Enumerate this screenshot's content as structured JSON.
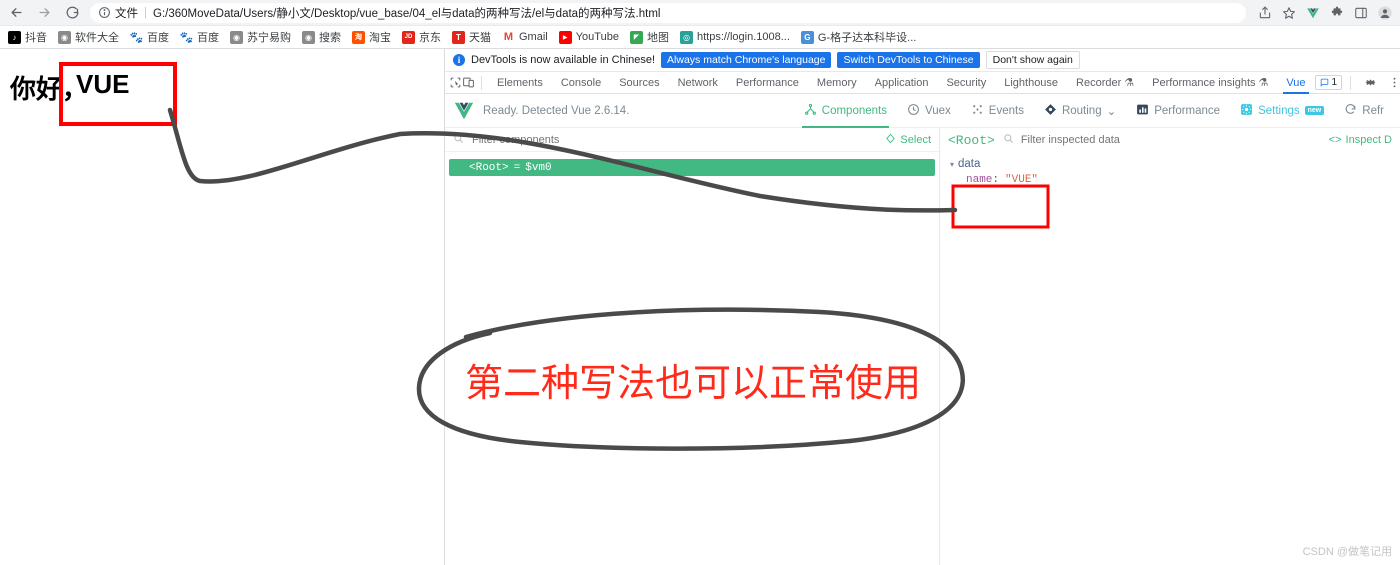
{
  "browser": {
    "nav": {
      "back": "Back",
      "forward": "Forward",
      "reload": "Reload"
    },
    "omnibox": {
      "scheme_label": "文件",
      "url": "G:/360MoveData/Users/静小文/Desktop/vue_base/04_el与data的两种写法/el与data的两种写法.html"
    },
    "toolbar_icons": [
      "share-icon",
      "bookmark-star-icon",
      "vue-extension-icon",
      "extensions-puzzle-icon",
      "side-panel-icon",
      "profile-icon"
    ],
    "bookmarks": [
      {
        "label": "抖音",
        "icon": "douyin-icon",
        "color": "#000000",
        "glyph": "♪"
      },
      {
        "label": "软件大全",
        "icon": "globe-icon",
        "color": "#7c7c7c",
        "glyph": "◉"
      },
      {
        "label": "百度",
        "icon": "baidu-icon",
        "color": "#2932e1",
        "glyph": "熊"
      },
      {
        "label": "百度",
        "icon": "baidu-icon",
        "color": "#2932e1",
        "glyph": "熊"
      },
      {
        "label": "苏宁易购",
        "icon": "globe-icon",
        "color": "#7c7c7c",
        "glyph": "◉"
      },
      {
        "label": "搜索",
        "icon": "globe-icon",
        "color": "#7c7c7c",
        "glyph": "◉"
      },
      {
        "label": "淘宝",
        "icon": "taobao-icon",
        "color": "#ff5000",
        "glyph": "淘"
      },
      {
        "label": "京东",
        "icon": "jd-icon",
        "color": "#e1251b",
        "glyph": "JD"
      },
      {
        "label": "天猫",
        "icon": "tmall-icon",
        "color": "#e1251b",
        "glyph": "T"
      },
      {
        "label": "Gmail",
        "icon": "gmail-icon",
        "color": "#ea4335",
        "glyph": "M"
      },
      {
        "label": "YouTube",
        "icon": "youtube-icon",
        "color": "#ff0000",
        "glyph": "▶"
      },
      {
        "label": "地图",
        "icon": "maps-icon",
        "color": "#34a853",
        "glyph": "◤"
      },
      {
        "label": "https://login.1008...",
        "icon": "globe-icon",
        "color": "#2aa198",
        "glyph": "◎"
      },
      {
        "label": "G-格子达本科毕设...",
        "icon": "globe-icon",
        "color": "#4a90d9",
        "glyph": "G"
      }
    ]
  },
  "page": {
    "greeting": "你好，",
    "name_value": "VUE"
  },
  "devtools": {
    "notice": {
      "icon": "info-icon",
      "message": "DevTools is now available in Chinese!",
      "buttons": [
        {
          "label": "Always match Chrome's language",
          "style": "primary"
        },
        {
          "label": "Switch DevTools to Chinese",
          "style": "primary"
        },
        {
          "label": "Don't show again",
          "style": "plain"
        }
      ]
    },
    "left_icons": [
      "inspect-element-icon",
      "device-toolbar-icon"
    ],
    "tabs": [
      {
        "label": "Elements",
        "active": false,
        "warning": false
      },
      {
        "label": "Console",
        "active": false,
        "warning": false
      },
      {
        "label": "Sources",
        "active": false,
        "warning": false
      },
      {
        "label": "Network",
        "active": false,
        "warning": false
      },
      {
        "label": "Performance",
        "active": false,
        "warning": false
      },
      {
        "label": "Memory",
        "active": false,
        "warning": false
      },
      {
        "label": "Application",
        "active": false,
        "warning": false
      },
      {
        "label": "Security",
        "active": false,
        "warning": false
      },
      {
        "label": "Lighthouse",
        "active": false,
        "warning": false
      },
      {
        "label": "Recorder",
        "active": false,
        "warning": true
      },
      {
        "label": "Performance insights",
        "active": false,
        "warning": true
      },
      {
        "label": "Vue",
        "active": true,
        "warning": false
      }
    ],
    "issues_count": "1",
    "settings_icon": "gear-icon",
    "more_icon": "kebab-menu-icon"
  },
  "vue_panel": {
    "logo": "vue-logo-icon",
    "status": "Ready. Detected Vue 2.6.14.",
    "nav": [
      {
        "label": "Components",
        "icon": "components-tree-icon",
        "active": true
      },
      {
        "label": "Vuex",
        "icon": "vuex-clock-icon",
        "active": false
      },
      {
        "label": "Events",
        "icon": "events-dots-icon",
        "active": false
      },
      {
        "label": "Routing",
        "icon": "routing-diamond-icon",
        "active": false,
        "caret": "⌄"
      },
      {
        "label": "Performance",
        "icon": "performance-bars-icon",
        "active": false
      },
      {
        "label": "Settings",
        "icon": "settings-gear-icon",
        "active": false,
        "badge": "new"
      },
      {
        "label": "Refr",
        "icon": "refresh-icon",
        "active": false
      }
    ],
    "tree": {
      "search_placeholder": "Filter components",
      "search_icon": "search-icon",
      "select_label": "Select",
      "select_icon": "select-target-icon",
      "rows": [
        {
          "component": "<Root>",
          "eq": "=",
          "vm": "$vm0",
          "selected": true
        }
      ]
    },
    "inspector": {
      "root_label": "<Root>",
      "search_icon": "search-icon",
      "search_placeholder": "Filter inspected data",
      "inspect_dom_label": "Inspect D",
      "inspect_dom_icon": "code-brackets-icon",
      "groups": [
        {
          "name": "data",
          "caret": "▾",
          "entries": [
            {
              "key": "name",
              "colon": ":",
              "value": "\"VUE\""
            }
          ]
        }
      ]
    }
  },
  "annotations": {
    "note_text": "第二种写法也可以正常使用",
    "note_color": "#ff2a1a",
    "box_color": "#ff0000",
    "line_color": "#555555"
  },
  "watermark": "CSDN @做笔记用"
}
